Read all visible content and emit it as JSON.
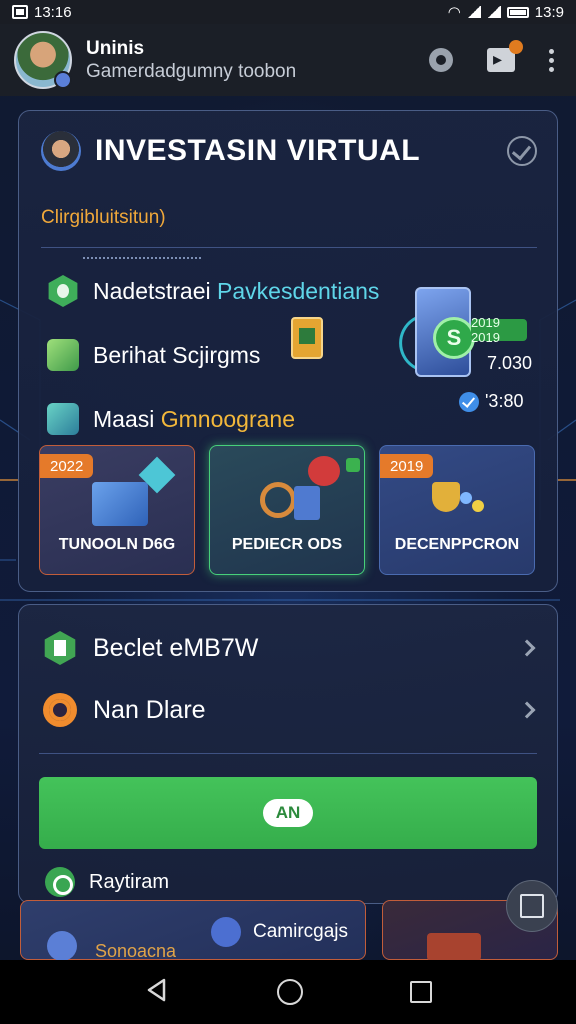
{
  "status_bar": {
    "time_left": "13:16",
    "time_right": "13:9"
  },
  "header": {
    "user_name": "Uninis",
    "user_subtitle": "Gamerdadgumny toobon",
    "icons": [
      "chat-icon",
      "video-icon",
      "more-icon"
    ]
  },
  "main_card": {
    "title": "INVESTASIN VIRTUAL",
    "subtitle": "Clirgibluitsitun)",
    "rows": [
      {
        "label": "Nadetstraei",
        "accent": "Pavkesdentians"
      },
      {
        "label": "Berihat Scjirgms"
      },
      {
        "label": "Maasi",
        "gold": "Gmnoograne"
      }
    ],
    "badge": "2019 2019",
    "stat_1": "7.030",
    "stat_2": "'3:80",
    "coin_symbol": "S",
    "tiles": [
      {
        "tag": "2022",
        "label": "TUNOOLN D6G"
      },
      {
        "tag": "",
        "label": "PEDIECR ODS"
      },
      {
        "tag": "2019",
        "label": "DECENPPCRON"
      }
    ]
  },
  "second_card": {
    "items": [
      {
        "label": "Beclet eMB7W"
      },
      {
        "label": "Nan Dlare"
      }
    ],
    "cta_label": "AN",
    "footer_label": "Raytiram"
  },
  "peek": {
    "left_label": "Sonoacna",
    "center_label": "Camircgajs"
  },
  "colors": {
    "accent_green": "#44c35a",
    "accent_orange": "#e57a2a",
    "card_border": "#4a5d86"
  }
}
